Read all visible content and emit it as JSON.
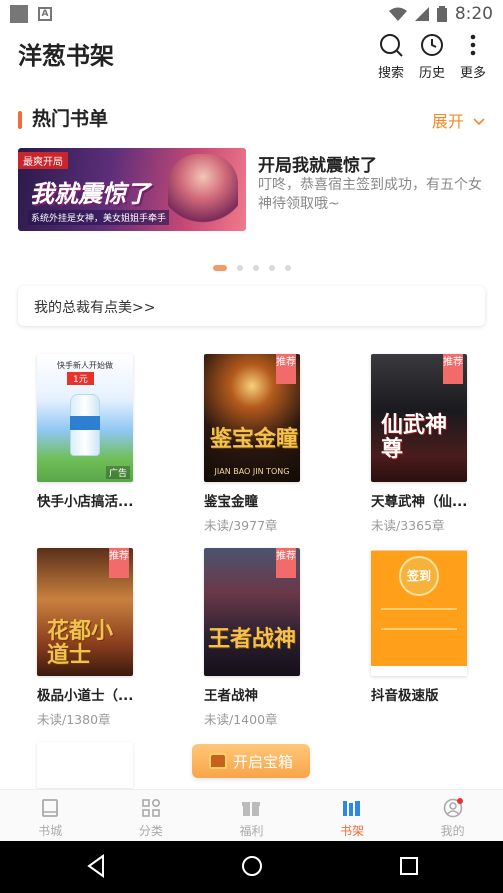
{
  "status": {
    "time": "8:20",
    "notif_badge": "A"
  },
  "header": {
    "title": "洋葱书架",
    "actions": [
      {
        "label": "搜索",
        "icon": "search-icon"
      },
      {
        "label": "历史",
        "icon": "clock-icon"
      },
      {
        "label": "更多",
        "icon": "more-vertical-icon"
      }
    ]
  },
  "section": {
    "title": "热门书单",
    "expand_label": "展开"
  },
  "banner": {
    "tag": "最爽开局",
    "image_title": "我就震惊了",
    "image_subtitle": "系统外挂是女神，美女姐姐手牵手",
    "title": "开局我就震惊了",
    "description": "叮咚，恭喜宿主签到成功，有五个女神待领取哦~"
  },
  "carousel": {
    "count": 5,
    "active": 0
  },
  "notice": {
    "text": "我的总裁有点美>>",
    "chevron": "›"
  },
  "books": [
    {
      "title": "快手小店搞活...",
      "meta": "",
      "ad_label": "广告",
      "cover_top": "快手新人开始做",
      "cover_price": "1元",
      "recommended": false
    },
    {
      "title": "鉴宝金瞳",
      "meta": "未读/3977章",
      "cover_title": "鉴宝金瞳",
      "cover_sub": "JIAN BAO JIN TONG",
      "recommended": true
    },
    {
      "title": "天尊武神（仙...",
      "meta": "未读/3365章",
      "cover_title": "仙武神尊",
      "recommended": true
    },
    {
      "title": "极品小道士（...",
      "meta": "未读/1380章",
      "cover_title": "花都小道士",
      "recommended": true
    },
    {
      "title": "王者战神",
      "meta": "未读/1400章",
      "cover_title": "王者战神",
      "recommended": true
    },
    {
      "title": "抖音极速版",
      "meta": "",
      "cover_title": "签到",
      "recommended": false
    }
  ],
  "recommend_label": "推荐",
  "treasure": {
    "label": "开启宝箱"
  },
  "tabs": [
    {
      "label": "书城",
      "icon": "book-icon",
      "active": false
    },
    {
      "label": "分类",
      "icon": "grid-icon",
      "active": false
    },
    {
      "label": "福利",
      "icon": "gift-icon",
      "active": false
    },
    {
      "label": "书架",
      "icon": "bookshelf-icon",
      "active": true
    },
    {
      "label": "我的",
      "icon": "profile-icon",
      "active": false
    }
  ],
  "colors": {
    "accent": "#f26b3a",
    "expand": "#f08a2c",
    "recommend": "#f26b6b"
  }
}
